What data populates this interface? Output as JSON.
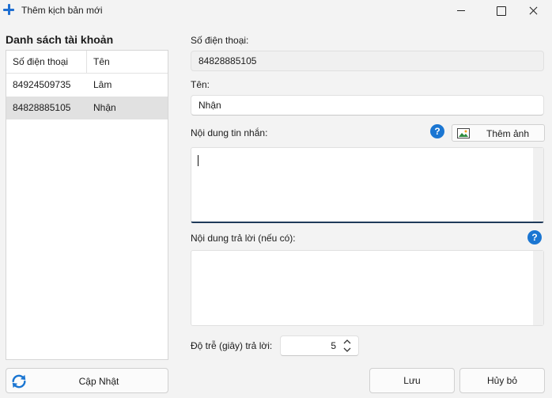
{
  "window": {
    "title": "Thêm kịch bản mới"
  },
  "accounts": {
    "title": "Danh sách tài khoản",
    "columns": [
      "Số điện thoại",
      "Tên"
    ],
    "rows": [
      {
        "phone": "84924509735",
        "name": "Lâm",
        "selected": false
      },
      {
        "phone": "84828885105",
        "name": "Nhận",
        "selected": true
      }
    ],
    "update_label": "Cập Nhật"
  },
  "form": {
    "phone_label": "Số điện thoại:",
    "phone_value": "84828885105",
    "name_label": "Tên:",
    "name_value": "Nhận",
    "message_label": "Nội dung tin nhắn:",
    "add_image_label": "Thêm ảnh",
    "message_value": "",
    "reply_label": "Nội dung trả lời (nếu có):",
    "reply_value": "",
    "delay_label": "Độ trễ (giây) trả lời:",
    "delay_value": "5",
    "help_glyph": "?"
  },
  "actions": {
    "save_label": "Lưu",
    "cancel_label": "Hủy bỏ"
  },
  "colors": {
    "accent": "#1b76d2",
    "selected_row": "#e1e1e1",
    "focus_border": "#1f3a5a"
  },
  "icons": [
    "plus-icon",
    "refresh-icon",
    "help-icon",
    "image-icon",
    "chevron-up-icon",
    "chevron-down-icon"
  ]
}
